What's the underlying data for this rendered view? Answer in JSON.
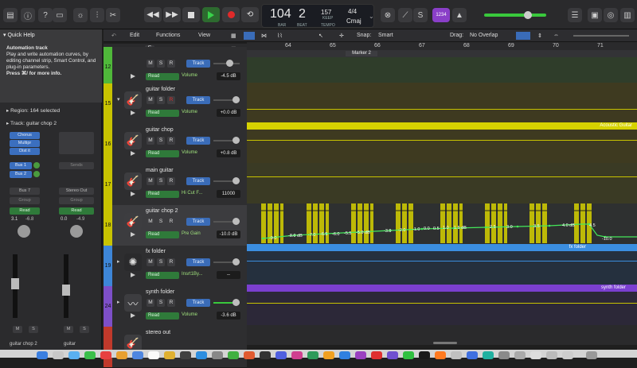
{
  "transport": {
    "tempo": "104",
    "bar_beat": "2",
    "bar_label": "BAR",
    "beat_label": "BEAT",
    "keep_value": "157",
    "keep_label": "KEEP",
    "tempo_label": "TEMPO",
    "signature": "4/4",
    "key": "Cmaj",
    "count_in": "1234"
  },
  "local_menu": {
    "edit": "Edit",
    "functions": "Functions",
    "view": "View",
    "snap_label": "Snap:",
    "snap_value": "Smart",
    "drag_label": "Drag:",
    "drag_value": "No Overlap"
  },
  "quick_help": {
    "title": "Quick Help",
    "heading": "Automation track",
    "body": "Play and write automation curves, by editing channel strip, Smart Control, and plug-in parameters.",
    "hint": "Press ⌘/ for more info."
  },
  "inspector": {
    "region": "Region: 164 selected",
    "track": "Track:  guitar chop 2"
  },
  "channel_strip_1": {
    "inserts": [
      "Chorus",
      "Multipr",
      "Dist it"
    ],
    "sends": [
      "Bus 1",
      "Bus 2"
    ],
    "output": "Bus 7",
    "group": "Group",
    "automation": "Read",
    "pan_value": "3.1",
    "level": "-6.8",
    "mute": "M",
    "solo": "S",
    "name": "guitar chop 2"
  },
  "channel_strip_2": {
    "sends_label": "Sends",
    "output": "Stereo Out",
    "group": "Group",
    "automation": "Read",
    "pan_value": "0.0",
    "level": "-4.9",
    "mute": "M",
    "solo": "S",
    "name": "guitar"
  },
  "ruler": {
    "bars": [
      "64",
      "65",
      "66",
      "67",
      "68",
      "69",
      "70",
      "71"
    ],
    "marker": "Marker 2"
  },
  "tracks": [
    {
      "number": "12",
      "name": "",
      "param": "Volume",
      "value": "-4.5 dB",
      "color": "#4fb83a"
    },
    {
      "number": "15",
      "name": "guitar folder",
      "param": "Volume",
      "value": "+0.0 dB",
      "color": "#c8c300"
    },
    {
      "number": "16",
      "name": "guitar chop",
      "param": "Volume",
      "value": "+0.8 dB",
      "color": "#c8c300"
    },
    {
      "number": "17",
      "name": "main guitar",
      "param": "Hi Cut F...",
      "value": "11000",
      "color": "#c8c300"
    },
    {
      "number": "18",
      "name": "guitar chop 2",
      "param": "Pre Gain",
      "value": "-10.0 dB",
      "color": "#c8c300"
    },
    {
      "number": "19",
      "name": "fx folder",
      "param": "Insrt1By...",
      "value": "--",
      "color": "#3d86d8"
    },
    {
      "number": "24",
      "name": "synth folder",
      "param": "Volume",
      "value": "-3.6 dB",
      "color": "#7d4fc8"
    },
    {
      "number": "",
      "name": "stereo out",
      "param": "",
      "value": "",
      "color": "#c0392b"
    }
  ],
  "track_buttons": {
    "mute": "M",
    "solo": "S",
    "record": "R",
    "track": "Track",
    "read": "Read"
  },
  "regions": {
    "acoustic": "Acoustic Guitar",
    "fx": "fx folder",
    "synth": "synth folder"
  },
  "automation_points": [
    "-9.0",
    "-8.0 dB",
    "-7.0",
    "-6.5",
    "-6.0",
    "-5.5",
    "-5.0 dB",
    "-3.0",
    "-2.0",
    "-1.0",
    "0.0",
    "0.5",
    "1.0",
    "1.5 dB",
    "2.5",
    "3.0",
    "3.5",
    "4.0 dB",
    "4.5",
    "-10.0"
  ],
  "colors": {
    "accent_green": "#28a745",
    "track_blue": "#3a6cb8",
    "record_red": "#e02a2a"
  }
}
